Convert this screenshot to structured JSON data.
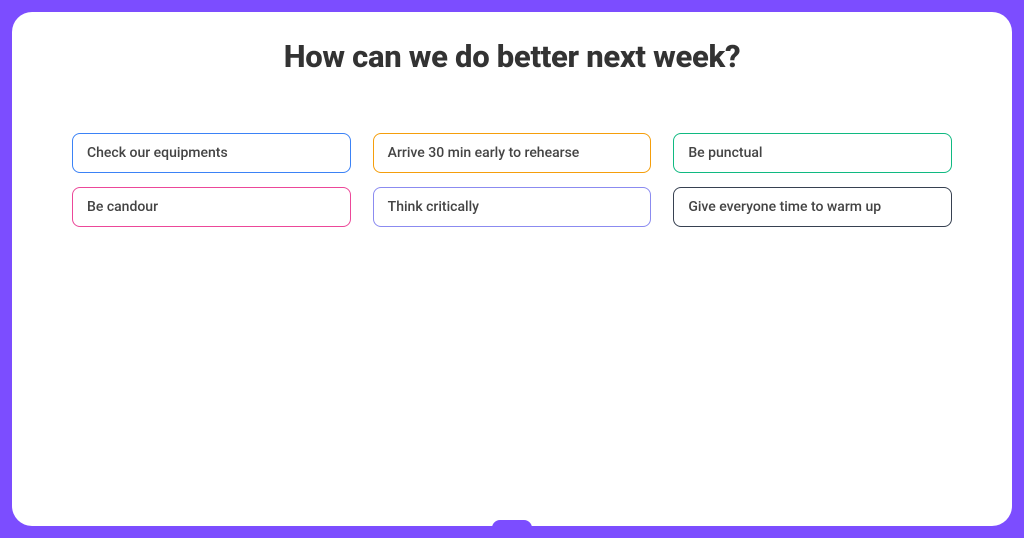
{
  "title": "How can we do better next week?",
  "options": [
    {
      "label": "Check our equipments",
      "color": "blue"
    },
    {
      "label": "Arrive 30 min early to rehearse",
      "color": "orange"
    },
    {
      "label": "Be punctual",
      "color": "green"
    },
    {
      "label": "Be candour",
      "color": "pink"
    },
    {
      "label": "Think critically",
      "color": "purple"
    },
    {
      "label": "Give everyone time to warm up",
      "color": "dark"
    }
  ]
}
